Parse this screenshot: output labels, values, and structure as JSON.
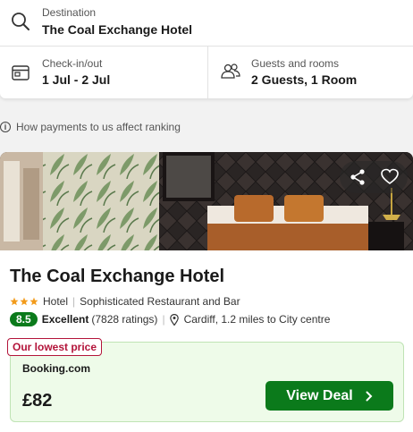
{
  "search": {
    "destination_label": "Destination",
    "destination_value": "The Coal Exchange Hotel",
    "checkin_label": "Check-in/out",
    "checkin_value": "1 Jul - 2 Jul",
    "guests_label": "Guests and rooms",
    "guests_value": "2 Guests, 1 Room"
  },
  "ranking_note": "How payments to us affect ranking",
  "hotel": {
    "name": "The Coal Exchange Hotel",
    "stars": 3,
    "type": "Hotel",
    "feature": "Sophisticated Restaurant and Bar",
    "score": "8.5",
    "rating_word": "Excellent",
    "rating_count": "(7828 ratings)",
    "location": "Cardiff, 1.2 miles to City centre"
  },
  "deal": {
    "badge": "Our lowest price",
    "provider": "Booking.com",
    "price": "£82",
    "button_label": "View Deal"
  },
  "colors": {
    "accent_green": "#0b7a1b",
    "badge_red": "#b3143a",
    "star_orange": "#f29b1b"
  },
  "icons": [
    "search-icon",
    "calendar-icon",
    "guests-icon",
    "info-icon",
    "share-icon",
    "heart-icon",
    "map-pin-icon",
    "chevron-right-icon"
  ]
}
